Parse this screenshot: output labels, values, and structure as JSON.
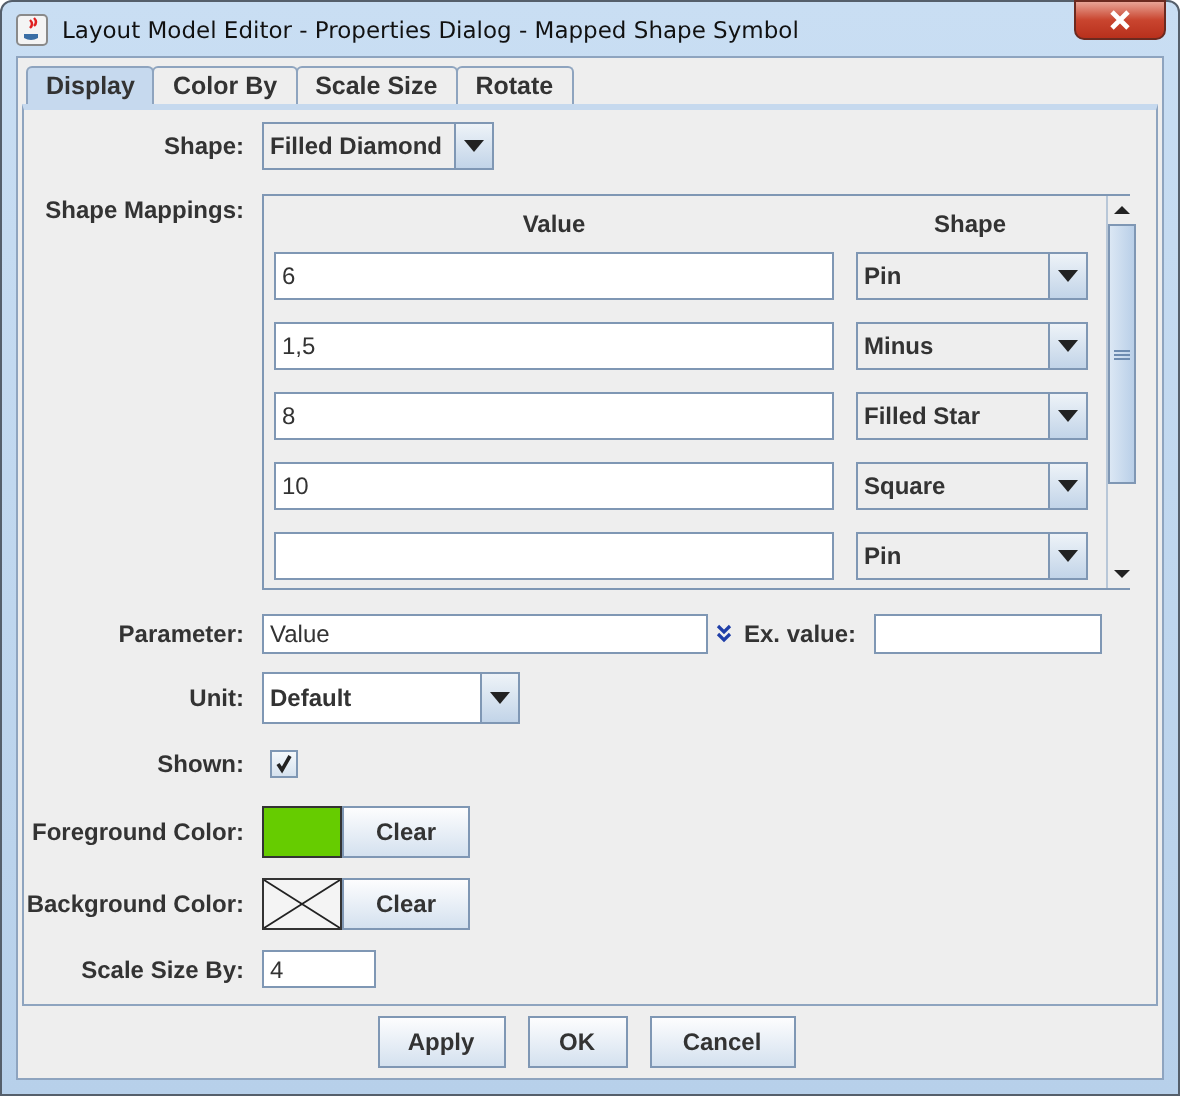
{
  "window": {
    "title": "Layout Model Editor - Properties Dialog - Mapped Shape Symbol"
  },
  "tabs": [
    {
      "label": "Display",
      "selected": true
    },
    {
      "label": "Color By",
      "selected": false
    },
    {
      "label": "Scale Size",
      "selected": false
    },
    {
      "label": "Rotate",
      "selected": false
    }
  ],
  "shape": {
    "label": "Shape:",
    "value": "Filled Diamond"
  },
  "shape_mappings": {
    "label": "Shape Mappings:",
    "columns": [
      "Value",
      "Shape"
    ],
    "rows": [
      {
        "value": "6",
        "shape": "Pin"
      },
      {
        "value": "1,5",
        "shape": "Minus"
      },
      {
        "value": "8",
        "shape": "Filled Star"
      },
      {
        "value": "10",
        "shape": "Square"
      },
      {
        "value": "",
        "shape": "Pin"
      }
    ]
  },
  "parameter": {
    "label": "Parameter:",
    "value": "Value",
    "ex_label": "Ex. value:"
  },
  "unit": {
    "label": "Unit:",
    "value": "Default"
  },
  "shown": {
    "label": "Shown:",
    "checked": true
  },
  "foreground_color": {
    "label": "Foreground Color:",
    "color": "#66cc00",
    "button": "Clear"
  },
  "background_color": {
    "label": "Background Color:",
    "button": "Clear"
  },
  "scale_size_by": {
    "label": "Scale Size By:",
    "value": "4"
  },
  "buttons": [
    "Apply",
    "OK",
    "Cancel"
  ]
}
